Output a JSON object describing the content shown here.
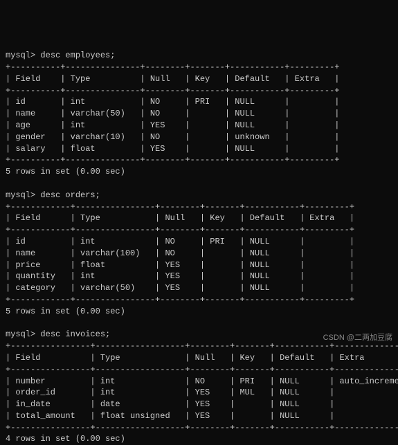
{
  "prompt": "mysql>",
  "commands": {
    "c1": "desc employees;",
    "c2": "desc orders;",
    "c3": "desc invoices;"
  },
  "headers": [
    "Field",
    "Type",
    "Null",
    "Key",
    "Default",
    "Extra"
  ],
  "tables": {
    "employees": {
      "cols": [
        8,
        13,
        6,
        5,
        9,
        7
      ],
      "rows": [
        [
          "id",
          "int",
          "NO",
          "PRI",
          "NULL",
          ""
        ],
        [
          "name",
          "varchar(50)",
          "NO",
          "",
          "NULL",
          ""
        ],
        [
          "age",
          "int",
          "YES",
          "",
          "NULL",
          ""
        ],
        [
          "gender",
          "varchar(10)",
          "NO",
          "",
          "unknown",
          ""
        ],
        [
          "salary",
          "float",
          "YES",
          "",
          "NULL",
          ""
        ]
      ],
      "summary": "5 rows in set (0.00 sec)"
    },
    "orders": {
      "cols": [
        10,
        14,
        6,
        5,
        9,
        7
      ],
      "rows": [
        [
          "id",
          "int",
          "NO",
          "PRI",
          "NULL",
          ""
        ],
        [
          "name",
          "varchar(100)",
          "NO",
          "",
          "NULL",
          ""
        ],
        [
          "price",
          "float",
          "YES",
          "",
          "NULL",
          ""
        ],
        [
          "quantity",
          "int",
          "YES",
          "",
          "NULL",
          ""
        ],
        [
          "category",
          "varchar(50)",
          "YES",
          "",
          "NULL",
          ""
        ]
      ],
      "summary": "5 rows in set (0.00 sec)"
    },
    "invoices": {
      "cols": [
        14,
        16,
        6,
        5,
        9,
        16
      ],
      "rows": [
        [
          "number",
          "int",
          "NO",
          "PRI",
          "NULL",
          "auto_increment"
        ],
        [
          "order_id",
          "int",
          "YES",
          "MUL",
          "NULL",
          ""
        ],
        [
          "in_date",
          "date",
          "YES",
          "",
          "NULL",
          ""
        ],
        [
          "total_amount",
          "float unsigned",
          "YES",
          "",
          "NULL",
          ""
        ]
      ],
      "summary": "4 rows in set (0.00 sec)"
    }
  },
  "watermark": "CSDN @二两加豆腐"
}
